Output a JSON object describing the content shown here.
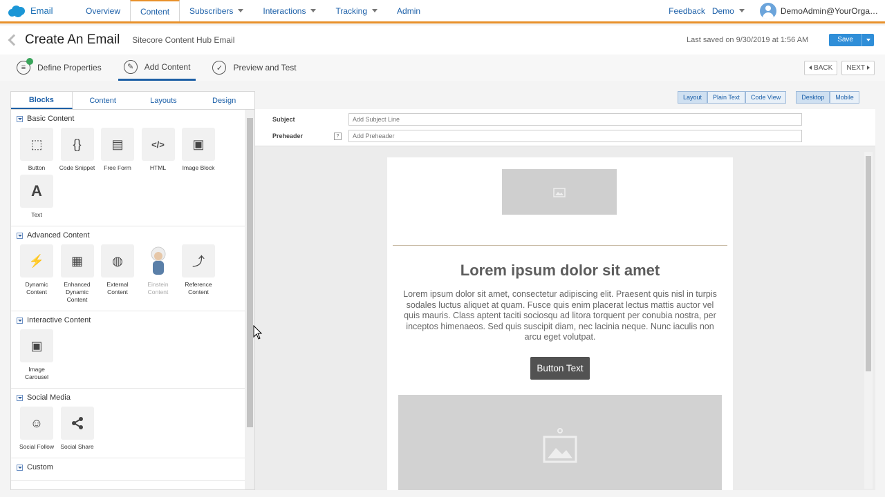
{
  "nav": {
    "brand": "Email",
    "items": [
      {
        "label": "Overview",
        "active": false,
        "dropdown": false
      },
      {
        "label": "Content",
        "active": true,
        "dropdown": false
      },
      {
        "label": "Subscribers",
        "active": false,
        "dropdown": true
      },
      {
        "label": "Interactions",
        "active": false,
        "dropdown": true
      },
      {
        "label": "Tracking",
        "active": false,
        "dropdown": true
      },
      {
        "label": "Admin",
        "active": false,
        "dropdown": false
      }
    ],
    "feedback": "Feedback",
    "org": "Demo",
    "user": "DemoAdmin@YourOrga…"
  },
  "header": {
    "title": "Create An Email",
    "subtitle": "Sitecore Content Hub Email",
    "last_saved": "Last saved on 9/30/2019 at 1:56 AM",
    "save": "Save"
  },
  "steps": {
    "items": [
      "Define Properties",
      "Add Content",
      "Preview and Test"
    ],
    "active_index": 1,
    "back": "BACK",
    "next": "NEXT"
  },
  "left_panel": {
    "tabs": [
      "Blocks",
      "Content",
      "Layouts",
      "Design"
    ],
    "active_tab": "Blocks",
    "sections": [
      {
        "title": "Basic Content",
        "blocks": [
          {
            "label": "Button",
            "icon": "cursor-click-icon"
          },
          {
            "label": "Code Snippet",
            "icon": "braces-icon"
          },
          {
            "label": "Free Form",
            "icon": "free-form-icon"
          },
          {
            "label": "HTML",
            "icon": "html-code-icon"
          },
          {
            "label": "Image Block",
            "icon": "image-icon"
          },
          {
            "label": "Text",
            "icon": "text-a-icon"
          }
        ]
      },
      {
        "title": "Advanced Content",
        "blocks": [
          {
            "label": "Dynamic Content",
            "icon": "lightning-icon"
          },
          {
            "label": "Enhanced Dynamic Content",
            "icon": "document-plus-icon"
          },
          {
            "label": "External Content",
            "icon": "globe-icon"
          },
          {
            "label": "Einstein Content",
            "icon": "einstein-icon"
          },
          {
            "label": "Reference Content",
            "icon": "reference-icon"
          }
        ]
      },
      {
        "title": "Interactive Content",
        "blocks": [
          {
            "label": "Image Carousel",
            "icon": "carousel-icon"
          }
        ]
      },
      {
        "title": "Social Media",
        "blocks": [
          {
            "label": "Social Follow",
            "icon": "social-follow-icon"
          },
          {
            "label": "Social Share",
            "icon": "share-icon"
          }
        ]
      },
      {
        "title": "Custom",
        "blocks": []
      }
    ]
  },
  "view_toggle": {
    "modes": [
      "Layout",
      "Plain Text",
      "Code View"
    ],
    "devices": [
      "Desktop",
      "Mobile"
    ],
    "selected_mode": "Layout",
    "selected_device": "Desktop"
  },
  "email_fields": {
    "subject_label": "Subject",
    "subject_placeholder": "Add Subject Line",
    "preheader_label": "Preheader",
    "preheader_help": "?",
    "preheader_placeholder": "Add Preheader"
  },
  "email": {
    "headline": "Lorem ipsum dolor sit amet",
    "body": "Lorem ipsum dolor sit amet, consectetur adipiscing elit. Praesent quis nisl in turpis sodales luctus aliquet at quam. Fusce quis enim placerat lectus mattis auctor vel quis mauris. Class aptent taciti sociosqu ad litora torquent per conubia nostra, per inceptos himenaeos. Sed quis suscipit diam, nec lacinia neque. Nunc iaculis non arcu eget volutpat.",
    "button": "Button Text"
  },
  "colors": {
    "accent_orange": "#e8902a",
    "link_blue": "#1b5fa8",
    "save_blue": "#2f8ed8",
    "success_green": "#3aa55b"
  }
}
